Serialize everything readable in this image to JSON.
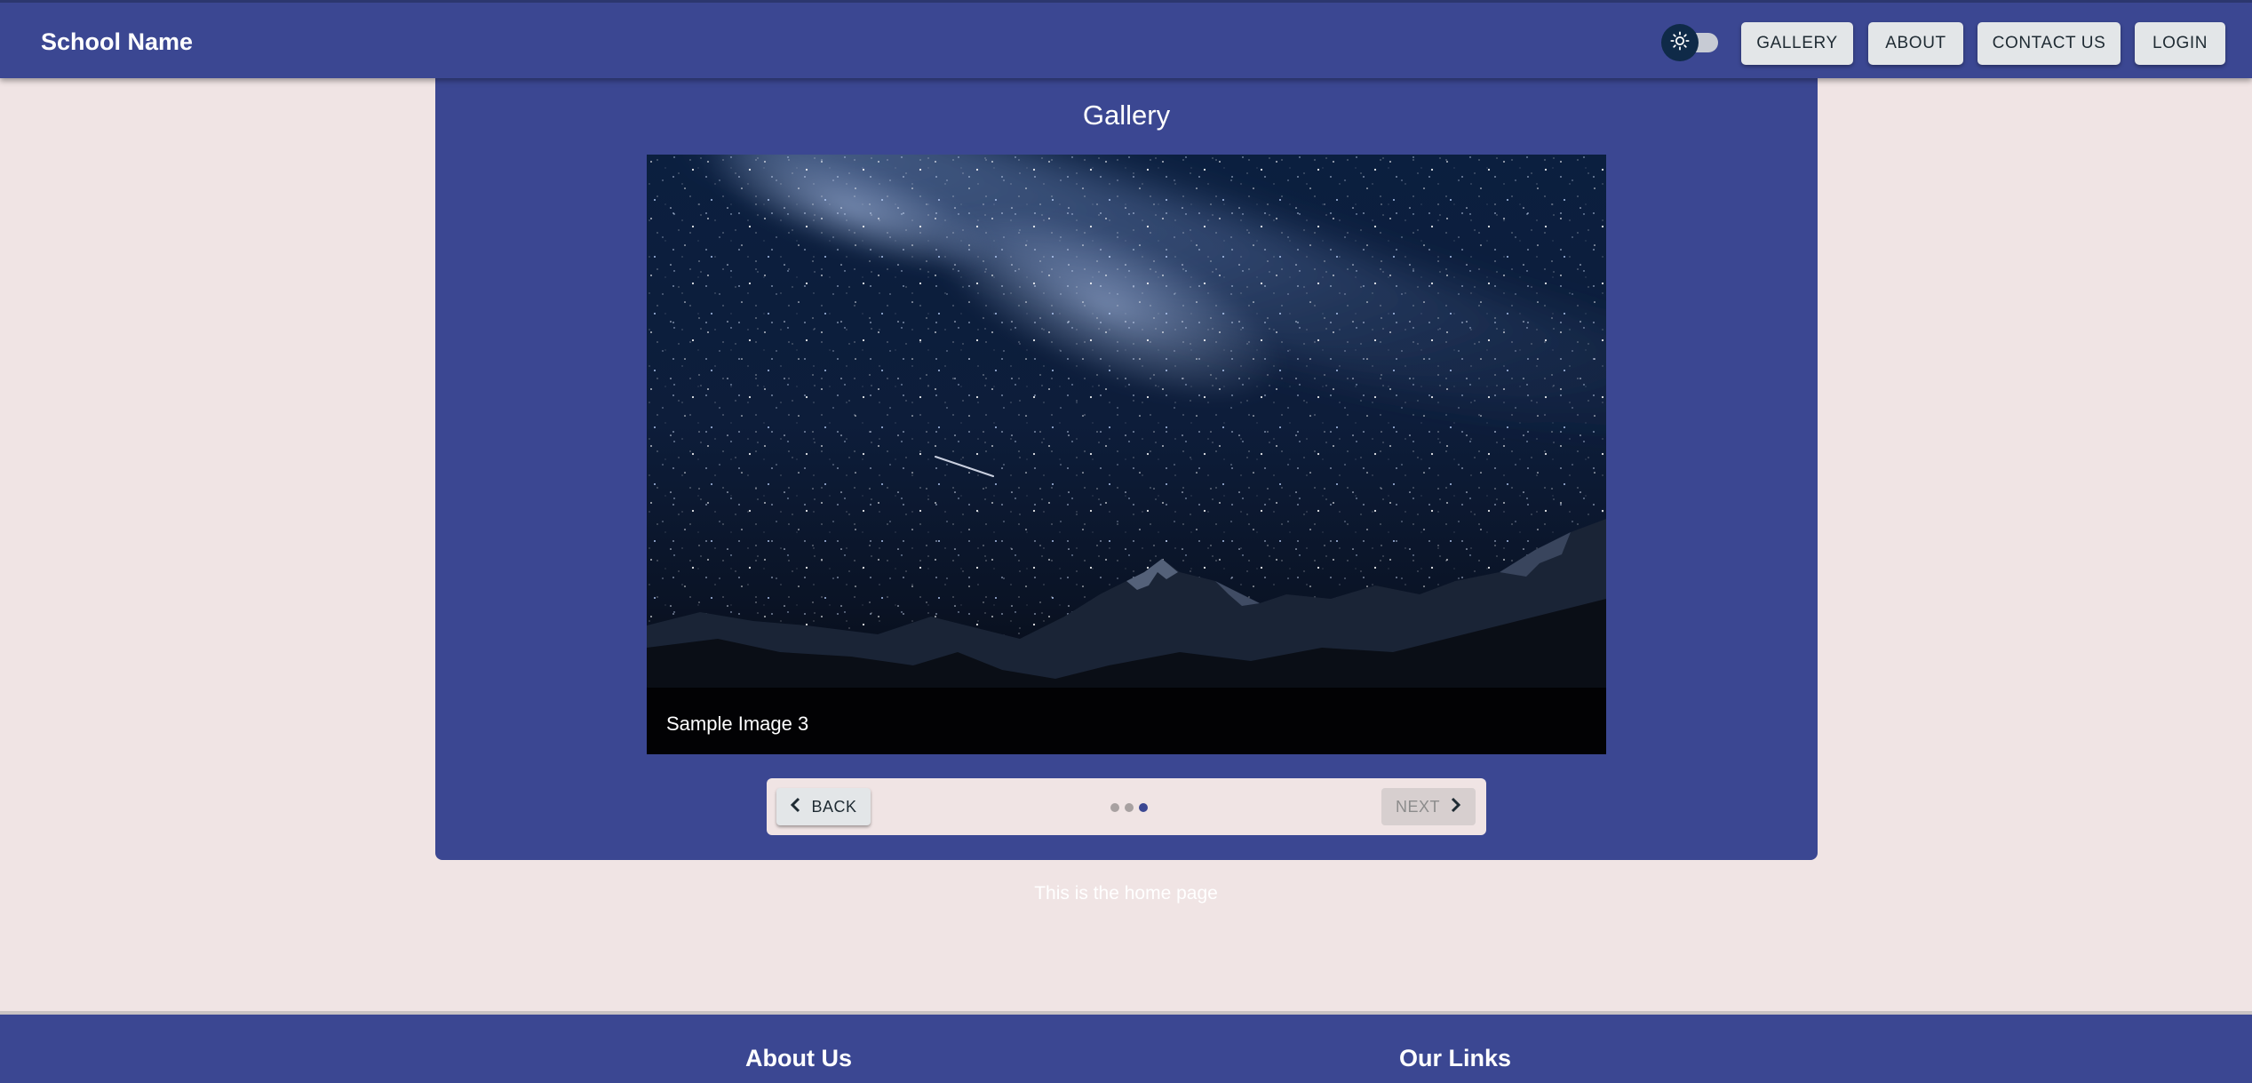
{
  "header": {
    "brand": "School Name",
    "theme_toggle_icon": "sun-icon",
    "nav": {
      "gallery": "GALLERY",
      "about": "ABOUT",
      "contact": "CONTACT US",
      "login": "LOGIN"
    }
  },
  "gallery": {
    "title": "Gallery",
    "caption": "Sample Image 3",
    "back_label": "BACK",
    "next_label": "NEXT",
    "step_count": 3,
    "active_step": 3
  },
  "main": {
    "home_text": "This is the home page"
  },
  "footer": {
    "about_heading": "About Us",
    "links_heading": "Our Links"
  },
  "colors": {
    "primary": "#3b4792",
    "background": "#f0e4e4",
    "button": "#e3e6e8",
    "toggle_thumb": "#0f2a48"
  }
}
